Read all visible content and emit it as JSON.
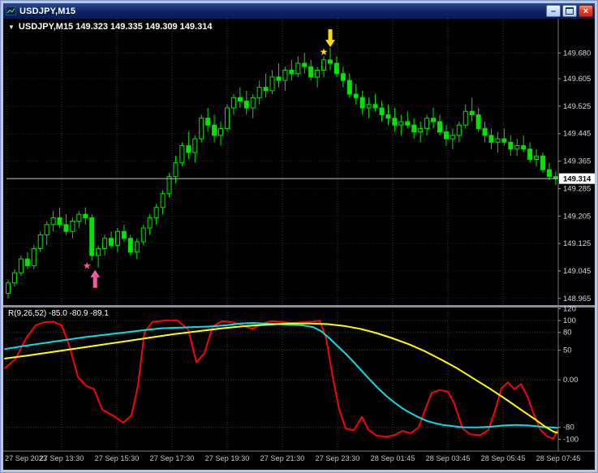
{
  "window": {
    "title": "USDJPY,M15",
    "controls": {
      "minimize_glyph": "–",
      "close_glyph": "×"
    }
  },
  "icons": {
    "dropdown_glyph": "▼"
  },
  "colors": {
    "candle": "#00e400",
    "background": "#000000",
    "grid": "#3a3a3a",
    "bid_line": "#c8c8c8",
    "titlebar": "#0b2363",
    "close_button": "#d43418",
    "buy_marker": "#ff55a3",
    "sell_marker": "#ffdd00"
  },
  "chart_data": {
    "type": "candlestick",
    "symbol": "USDJPY",
    "timeframe": "M15",
    "header_text": "USDJPY,M15 149.323 149.335 149.309 149.314",
    "ohlc": [
      "149.323",
      "149.335",
      "149.309",
      "149.314"
    ],
    "price_axis": {
      "max": 149.78,
      "min": 148.948,
      "current": "149.314",
      "current_value": 149.314,
      "labels": [
        "149.680",
        "149.605",
        "149.525",
        "149.445",
        "149.365",
        "149.285",
        "149.205",
        "149.125",
        "149.045",
        "148.965"
      ]
    },
    "time_axis": {
      "labels": [
        "27 Sep 2023",
        "27 Sep 13:30",
        "27 Sep 15:30",
        "27 Sep 17:30",
        "27 Sep 19:30",
        "27 Sep 21:30",
        "27 Sep 23:30",
        "28 Sep 01:45",
        "28 Sep 03:45",
        "28 Sep 05:45",
        "28 Sep 07:45"
      ]
    },
    "candles": [
      [
        148.98,
        149.02,
        148.965,
        149.01
      ],
      [
        149.01,
        149.05,
        149.0,
        149.04
      ],
      [
        149.04,
        149.09,
        149.03,
        149.08
      ],
      [
        149.08,
        149.1,
        149.05,
        149.06
      ],
      [
        149.06,
        149.12,
        149.05,
        149.11
      ],
      [
        149.11,
        149.16,
        149.1,
        149.15
      ],
      [
        149.15,
        149.19,
        149.12,
        149.18
      ],
      [
        149.18,
        149.22,
        149.16,
        149.2
      ],
      [
        149.2,
        149.23,
        149.17,
        149.18
      ],
      [
        149.18,
        149.21,
        149.15,
        149.16
      ],
      [
        149.16,
        149.2,
        149.14,
        149.19
      ],
      [
        149.19,
        149.22,
        149.17,
        149.21
      ],
      [
        149.21,
        149.23,
        149.18,
        149.2
      ],
      [
        149.2,
        149.21,
        149.075,
        149.09
      ],
      [
        149.09,
        149.12,
        149.055,
        149.11
      ],
      [
        149.11,
        149.15,
        149.09,
        149.14
      ],
      [
        149.14,
        149.16,
        149.11,
        149.12
      ],
      [
        149.12,
        149.17,
        149.1,
        149.16
      ],
      [
        149.16,
        149.18,
        149.13,
        149.14
      ],
      [
        149.14,
        149.15,
        149.09,
        149.1
      ],
      [
        149.1,
        149.14,
        149.08,
        149.13
      ],
      [
        149.13,
        149.18,
        149.12,
        149.17
      ],
      [
        149.17,
        149.21,
        149.15,
        149.2
      ],
      [
        149.2,
        149.24,
        149.18,
        149.23
      ],
      [
        149.23,
        149.28,
        149.21,
        149.27
      ],
      [
        149.27,
        149.33,
        149.26,
        149.32
      ],
      [
        149.32,
        149.38,
        149.3,
        149.36
      ],
      [
        149.36,
        149.42,
        149.35,
        149.41
      ],
      [
        149.41,
        149.45,
        149.37,
        149.39
      ],
      [
        149.39,
        149.44,
        149.36,
        149.43
      ],
      [
        149.43,
        149.5,
        149.42,
        149.49
      ],
      [
        149.49,
        149.52,
        149.45,
        149.47
      ],
      [
        149.47,
        149.5,
        149.42,
        149.44
      ],
      [
        149.44,
        149.48,
        149.41,
        149.46
      ],
      [
        149.46,
        149.53,
        149.45,
        149.52
      ],
      [
        149.52,
        149.56,
        149.5,
        149.55
      ],
      [
        149.55,
        149.58,
        149.52,
        149.54
      ],
      [
        149.54,
        149.57,
        149.5,
        149.52
      ],
      [
        149.52,
        149.56,
        149.49,
        149.55
      ],
      [
        149.55,
        149.6,
        149.53,
        149.58
      ],
      [
        149.58,
        149.62,
        149.55,
        149.57
      ],
      [
        149.57,
        149.63,
        149.56,
        149.61
      ],
      [
        149.61,
        149.65,
        149.58,
        149.6
      ],
      [
        149.6,
        149.64,
        149.57,
        149.63
      ],
      [
        149.63,
        149.66,
        149.6,
        149.62
      ],
      [
        149.62,
        149.67,
        149.61,
        149.65
      ],
      [
        149.65,
        149.68,
        149.62,
        149.64
      ],
      [
        149.64,
        149.66,
        149.6,
        149.61
      ],
      [
        149.61,
        149.64,
        149.58,
        149.63
      ],
      [
        149.63,
        149.67,
        149.61,
        149.66
      ],
      [
        149.66,
        149.695,
        149.63,
        149.65
      ],
      [
        149.65,
        149.67,
        149.61,
        149.62
      ],
      [
        149.62,
        149.64,
        149.58,
        149.6
      ],
      [
        149.6,
        149.62,
        149.55,
        149.56
      ],
      [
        149.56,
        149.59,
        149.53,
        149.55
      ],
      [
        149.55,
        149.57,
        149.5,
        149.52
      ],
      [
        149.52,
        149.55,
        149.49,
        149.53
      ],
      [
        149.53,
        149.56,
        149.51,
        149.52
      ],
      [
        149.52,
        149.54,
        149.48,
        149.5
      ],
      [
        149.5,
        149.53,
        149.47,
        149.49
      ],
      [
        149.49,
        149.52,
        149.45,
        149.47
      ],
      [
        149.47,
        149.5,
        149.44,
        149.48
      ],
      [
        149.48,
        149.51,
        149.46,
        149.47
      ],
      [
        149.47,
        149.49,
        149.43,
        149.45
      ],
      [
        149.45,
        149.48,
        149.42,
        149.46
      ],
      [
        149.46,
        149.5,
        149.44,
        149.49
      ],
      [
        149.49,
        149.52,
        149.46,
        149.48
      ],
      [
        149.48,
        149.5,
        149.44,
        149.45
      ],
      [
        149.45,
        149.47,
        149.41,
        149.43
      ],
      [
        149.43,
        149.46,
        149.4,
        149.44
      ],
      [
        149.44,
        149.48,
        149.42,
        149.47
      ],
      [
        149.47,
        149.53,
        149.46,
        149.51
      ],
      [
        149.51,
        149.55,
        149.48,
        149.5
      ],
      [
        149.5,
        149.52,
        149.45,
        149.46
      ],
      [
        149.46,
        149.48,
        149.42,
        149.44
      ],
      [
        149.44,
        149.46,
        149.4,
        149.42
      ],
      [
        149.42,
        149.45,
        149.39,
        149.43
      ],
      [
        149.43,
        149.46,
        149.41,
        149.42
      ],
      [
        149.42,
        149.44,
        149.38,
        149.4
      ],
      [
        149.4,
        149.43,
        149.38,
        149.41
      ],
      [
        149.41,
        149.44,
        149.39,
        149.4
      ],
      [
        149.4,
        149.42,
        149.36,
        149.37
      ],
      [
        149.37,
        149.4,
        149.35,
        149.38
      ],
      [
        149.38,
        149.39,
        149.33,
        149.34
      ],
      [
        149.34,
        149.36,
        149.31,
        149.32
      ],
      [
        149.32,
        149.335,
        149.295,
        149.314
      ]
    ],
    "markers": {
      "buy": {
        "candle_index": 13,
        "star_price": 149.06,
        "arrow_price": 149.048,
        "color": "#ff55a3"
      },
      "sell": {
        "candle_index": 50,
        "star_price": 149.683,
        "arrow_price": 149.697,
        "color": "#ffdd00"
      }
    },
    "indicator": {
      "label": "R(9,26,52) -85.0 -80.9 -89.1",
      "name": "R",
      "params": "9,26,52",
      "current_values": [
        "-85.0",
        "-80.9",
        "-89.1"
      ],
      "axis_labels": [
        "120",
        "100",
        "80",
        "50",
        "0.00",
        "-80",
        "-100"
      ],
      "range": [
        -120,
        122
      ],
      "levels": [
        100,
        80,
        50,
        0,
        -80
      ],
      "series": [
        {
          "name": "r9",
          "color": "#ff0000",
          "points": [
            [
              2,
              20
            ],
            [
              15,
              35
            ],
            [
              28,
              70
            ],
            [
              40,
              92
            ],
            [
              50,
              97
            ],
            [
              62,
              98
            ],
            [
              72,
              92
            ],
            [
              82,
              55
            ],
            [
              92,
              5
            ],
            [
              102,
              -10
            ],
            [
              112,
              -16
            ],
            [
              122,
              -50
            ],
            [
              135,
              -60
            ],
            [
              148,
              -72
            ],
            [
              158,
              -60
            ],
            [
              166,
              -10
            ],
            [
              174,
              80
            ],
            [
              184,
              98
            ],
            [
              200,
              100
            ],
            [
              215,
              100
            ],
            [
              228,
              85
            ],
            [
              238,
              30
            ],
            [
              248,
              45
            ],
            [
              258,
              90
            ],
            [
              270,
              99
            ],
            [
              283,
              97
            ],
            [
              295,
              92
            ],
            [
              307,
              86
            ],
            [
              318,
              94
            ],
            [
              330,
              99
            ],
            [
              342,
              98
            ],
            [
              355,
              96
            ],
            [
              368,
              97
            ],
            [
              380,
              98
            ],
            [
              390,
              100
            ],
            [
              398,
              70
            ],
            [
              406,
              5
            ],
            [
              414,
              -50
            ],
            [
              422,
              -82
            ],
            [
              432,
              -85
            ],
            [
              442,
              -62
            ],
            [
              450,
              -84
            ],
            [
              460,
              -94
            ],
            [
              472,
              -96
            ],
            [
              482,
              -93
            ],
            [
              492,
              -86
            ],
            [
              502,
              -90
            ],
            [
              512,
              -80
            ],
            [
              520,
              -50
            ],
            [
              528,
              -22
            ],
            [
              538,
              -17
            ],
            [
              548,
              -20
            ],
            [
              556,
              -40
            ],
            [
              566,
              -82
            ],
            [
              576,
              -92
            ],
            [
              588,
              -93
            ],
            [
              598,
              -84
            ],
            [
              606,
              -52
            ],
            [
              614,
              -14
            ],
            [
              622,
              -4
            ],
            [
              630,
              -16
            ],
            [
              638,
              -7
            ],
            [
              646,
              -28
            ],
            [
              654,
              -58
            ],
            [
              662,
              -84
            ],
            [
              670,
              -95
            ],
            [
              678,
              -99
            ],
            [
              683,
              -85
            ]
          ]
        },
        {
          "name": "r26",
          "color": "#00e0e8",
          "points": [
            [
              2,
              52
            ],
            [
              25,
              57
            ],
            [
              50,
              62
            ],
            [
              75,
              67
            ],
            [
              100,
              72
            ],
            [
              125,
              76
            ],
            [
              150,
              80
            ],
            [
              175,
              84
            ],
            [
              195,
              87
            ],
            [
              215,
              88
            ],
            [
              235,
              89
            ],
            [
              255,
              90
            ],
            [
              275,
              92
            ],
            [
              292,
              95
            ],
            [
              308,
              96
            ],
            [
              322,
              95
            ],
            [
              338,
              94
            ],
            [
              352,
              93
            ],
            [
              368,
              92
            ],
            [
              382,
              89
            ],
            [
              392,
              82
            ],
            [
              402,
              70
            ],
            [
              412,
              57
            ],
            [
              422,
              44
            ],
            [
              432,
              30
            ],
            [
              442,
              15
            ],
            [
              452,
              0
            ],
            [
              462,
              -14
            ],
            [
              472,
              -27
            ],
            [
              482,
              -38
            ],
            [
              492,
              -48
            ],
            [
              502,
              -56
            ],
            [
              512,
              -63
            ],
            [
              522,
              -69
            ],
            [
              532,
              -73
            ],
            [
              542,
              -76
            ],
            [
              554,
              -78
            ],
            [
              568,
              -80
            ],
            [
              584,
              -80
            ],
            [
              600,
              -79
            ],
            [
              616,
              -77
            ],
            [
              632,
              -76
            ],
            [
              648,
              -77
            ],
            [
              664,
              -79
            ],
            [
              683,
              -80.9
            ]
          ]
        },
        {
          "name": "r52",
          "color": "#ffff00",
          "points": [
            [
              2,
              36
            ],
            [
              30,
              41
            ],
            [
              60,
              47
            ],
            [
              90,
              53
            ],
            [
              120,
              59
            ],
            [
              150,
              65
            ],
            [
              180,
              71
            ],
            [
              210,
              77
            ],
            [
              240,
              82
            ],
            [
              270,
              87
            ],
            [
              300,
              91
            ],
            [
              325,
              93
            ],
            [
              350,
              95
            ],
            [
              375,
              95
            ],
            [
              400,
              94
            ],
            [
              420,
              91
            ],
            [
              440,
              86
            ],
            [
              460,
              79
            ],
            [
              480,
              70
            ],
            [
              500,
              60
            ],
            [
              520,
              48
            ],
            [
              540,
              34
            ],
            [
              560,
              19
            ],
            [
              580,
              2
            ],
            [
              600,
              -15
            ],
            [
              620,
              -33
            ],
            [
              640,
              -52
            ],
            [
              656,
              -67
            ],
            [
              668,
              -79
            ],
            [
              678,
              -87
            ],
            [
              683,
              -89.1
            ]
          ]
        }
      ]
    }
  }
}
